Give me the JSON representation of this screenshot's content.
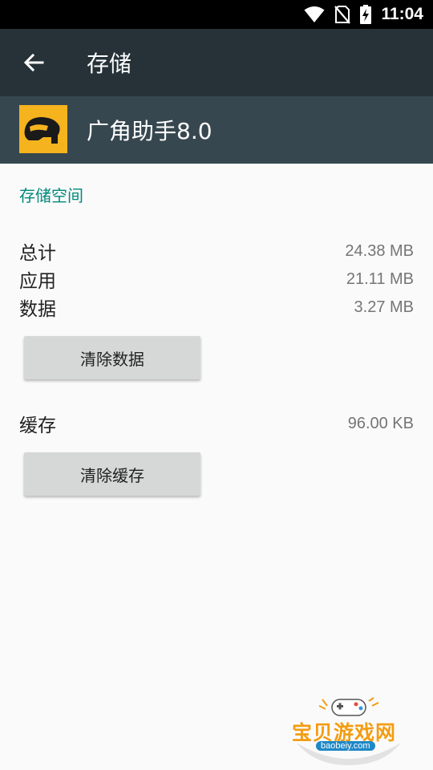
{
  "status_bar": {
    "time": "11:04",
    "icons": [
      "wifi-icon",
      "no-sim-icon",
      "battery-charging-icon"
    ]
  },
  "toolbar": {
    "back_icon": "arrow-left-icon",
    "title": "存储"
  },
  "app": {
    "name": "广角助手8.0",
    "icon": "helmet-icon",
    "icon_bg": "#f5b31e"
  },
  "storage": {
    "section_title": "存储空间",
    "rows": [
      {
        "label": "总计",
        "value": "24.38 MB"
      },
      {
        "label": "应用",
        "value": "21.11 MB"
      },
      {
        "label": "数据",
        "value": "3.27 MB"
      }
    ],
    "clear_data_label": "清除数据"
  },
  "cache": {
    "label": "缓存",
    "value": "96.00 KB",
    "clear_cache_label": "清除缓存"
  },
  "watermark": {
    "text": "宝贝游戏网",
    "url": "baobeiy.com"
  },
  "colors": {
    "toolbar_bg": "#263238",
    "app_header_bg": "#37474f",
    "accent": "#00897b",
    "button_bg": "#d6d7d7"
  }
}
